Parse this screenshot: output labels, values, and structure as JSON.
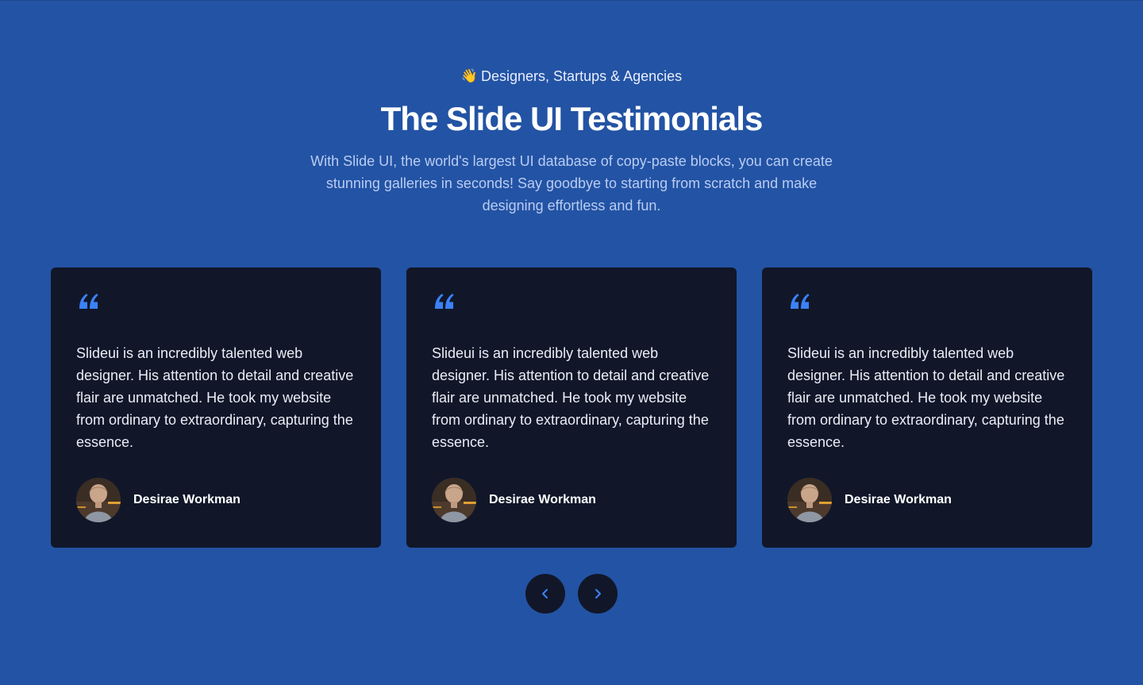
{
  "header": {
    "eyebrow_icon": "waving-hand-icon",
    "eyebrow": "Designers, Startups & Agencies",
    "title": "The Slide UI Testimonials",
    "description": "With Slide UI, the world's largest UI database of copy-paste blocks, you can create stunning galleries in seconds! Say goodbye to starting from scratch and make designing effortless and fun."
  },
  "colors": {
    "background": "#2353a4",
    "card": "#111729",
    "accent": "#3b82f6"
  },
  "testimonials": [
    {
      "quote_icon": "quote-icon",
      "text": "Slideui is an incredibly talented web designer. His attention to detail and creative flair are unmatched. He took my website from ordinary to extraordinary, capturing the essence.",
      "author": "Desirae Workman"
    },
    {
      "quote_icon": "quote-icon",
      "text": "Slideui is an incredibly talented web designer. His attention to detail and creative flair are unmatched. He took my website from ordinary to extraordinary, capturing the essence.",
      "author": "Desirae Workman"
    },
    {
      "quote_icon": "quote-icon",
      "text": "Slideui is an incredibly talented web designer. His attention to detail and creative flair are unmatched. He took my website from ordinary to extraordinary, capturing the essence.",
      "author": "Desirae Workman"
    }
  ],
  "navigation": {
    "prev_icon": "chevron-left-icon",
    "next_icon": "chevron-right-icon"
  }
}
